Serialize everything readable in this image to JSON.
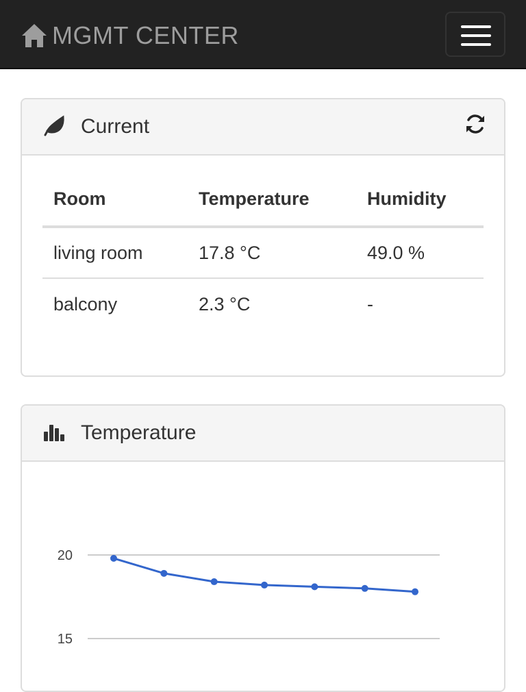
{
  "navbar": {
    "brand": "MGMT CENTER",
    "brand_icon": "home-icon",
    "menu_icon": "hamburger-menu-icon"
  },
  "current": {
    "title": "Current",
    "icon": "leaf-icon",
    "refresh_icon": "refresh-icon",
    "headers": [
      "Room",
      "Temperature",
      "Humidity"
    ],
    "rows": [
      [
        "living room",
        "17.8 °C",
        "49.0 %"
      ],
      [
        "balcony",
        "2.3 °C",
        "-"
      ]
    ]
  },
  "temperature": {
    "title": "Temperature",
    "icon": "bar-chart-icon"
  },
  "chart_data": {
    "type": "line",
    "title": "",
    "xlabel": "",
    "ylabel": "",
    "y_ticks": [
      20,
      15
    ],
    "ylim": [
      15,
      20
    ],
    "grid": true,
    "color": "#3366cc",
    "series": [
      {
        "values": [
          19.8,
          18.9,
          18.4,
          18.2,
          18.1,
          18.0,
          17.8
        ]
      }
    ]
  }
}
